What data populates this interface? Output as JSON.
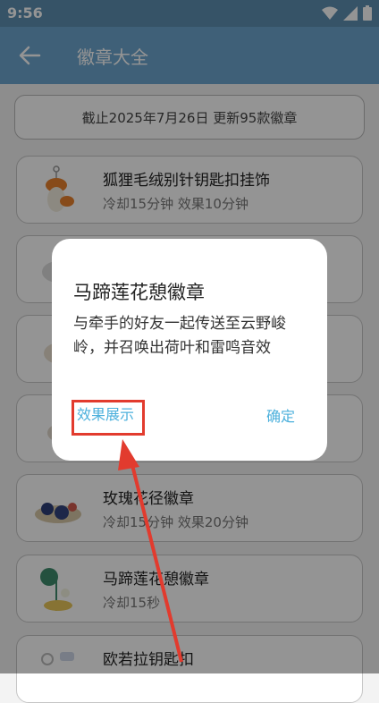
{
  "status_bar": {
    "time": "9:56"
  },
  "app_bar": {
    "title": "徽章大全"
  },
  "banner": {
    "text": "截止2025年7月26日 更新95款徽章"
  },
  "cards": [
    {
      "name": "狐狸毛绒别针钥匙扣挂饰",
      "desc": "冷却15分钟 效果10分钟"
    },
    {
      "name": "",
      "desc": ""
    },
    {
      "name": "",
      "desc": ""
    },
    {
      "name": "",
      "desc": ""
    },
    {
      "name": "玫瑰花径徽章",
      "desc": "冷却15分钟 效果20分钟"
    },
    {
      "name": "马蹄莲花憩徽章",
      "desc": "冷却15秒"
    },
    {
      "name": "欧若拉钥匙扣",
      "desc": ""
    }
  ],
  "dialog": {
    "title": "马蹄莲花憩徽章",
    "body": "与牵手的好友一起传送至云野峻岭，并召唤出荷叶和雷鸣音效",
    "effect_button": "效果展示",
    "ok_button": "确定"
  },
  "colors": {
    "app_bar": "#6da6cf",
    "status_bar": "#5d8fb2",
    "dialog_button": "#4cb0dc",
    "highlight": "#e23b2e"
  },
  "icons": [
    "back-arrow-icon",
    "wifi-icon",
    "signal-icon",
    "battery-icon"
  ]
}
